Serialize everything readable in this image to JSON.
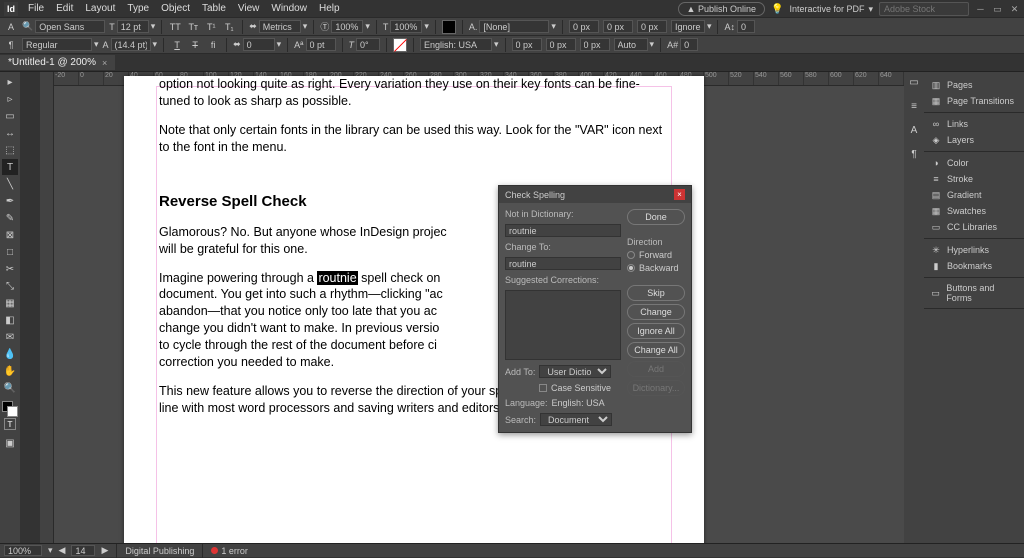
{
  "app": {
    "logo_letter": "Id"
  },
  "menu": [
    "File",
    "Edit",
    "Layout",
    "Type",
    "Object",
    "Table",
    "View",
    "Window",
    "Help"
  ],
  "topright": {
    "publish": "Publish Online",
    "preset_label": "Interactive for PDF",
    "search_placeholder": "Adobe Stock"
  },
  "control": {
    "font": "Open Sans",
    "weight": "Regular",
    "size": "12 pt",
    "leading": "(14.4 pt)",
    "metrics": "Metrics",
    "tracking": "0",
    "vscale": "100%",
    "hscale": "100%",
    "baseline": "0 pt",
    "skew": "0°",
    "lang": "English: USA",
    "para_style": "[None]",
    "zero": "0 px",
    "auto": "Auto",
    "ignore": "Ignore"
  },
  "tab": {
    "title": "*Untitled-1 @ 200%"
  },
  "ruler_ticks": [
    "-20",
    "0",
    "20",
    "40",
    "60",
    "80",
    "100",
    "120",
    "140",
    "160",
    "180",
    "200",
    "220",
    "240",
    "260",
    "280",
    "300",
    "320",
    "340",
    "360",
    "380",
    "400",
    "420",
    "440",
    "460",
    "480",
    "500",
    "520",
    "540",
    "560",
    "580",
    "600",
    "620",
    "640"
  ],
  "document": {
    "p1": "option not looking quite as right. Every variation they use on their key fonts can be fine-tuned to look as sharp as possible.",
    "p2": "Note that only certain fonts in the library can be used this way. Look for the \"VAR\" icon next to the font in the menu.",
    "h1": "Reverse Spell Check",
    "p3a": "Glamorous? No. But anyone whose InDesign projec",
    "p3b": "will be grateful for this one.",
    "p4a": "Imagine powering through a ",
    "p4b_hl": "routnie",
    "p4c": " spell check on",
    "p4d": "document. You get into such a rhythm—clicking \"ac",
    "p4e": "abandon—that you notice only too late that you ac",
    "p4f": "change you didn't want to make. In previous versio",
    "p4g": "to cycle through the rest of the document before ci",
    "p4h": "correction you needed to make.",
    "p5": "This new feature allows you to reverse the direction of your spell check, bringing InDesign in line with most word processors and saving writers and editors a lot of stress and time."
  },
  "dialog": {
    "title": "Check Spelling",
    "not_in_dict_label": "Not in Dictionary:",
    "not_in_dict_value": "routnie",
    "change_to_label": "Change To:",
    "change_to_value": "routine",
    "suggested_label": "Suggested Corrections:",
    "direction_label": "Direction",
    "forward": "Forward",
    "backward": "Backward",
    "done": "Done",
    "skip": "Skip",
    "change": "Change",
    "ignore_all": "Ignore All",
    "change_all": "Change All",
    "add": "Add",
    "dictionary": "Dictionary...",
    "add_to_label": "Add To:",
    "add_to_value": "User Dictionary",
    "case_sensitive": "Case Sensitive",
    "language_label": "Language:",
    "language_value": "English: USA",
    "search_label": "Search:",
    "search_value": "Document"
  },
  "right_panel": {
    "pages": "Pages",
    "page_transitions": "Page Transitions",
    "links": "Links",
    "layers": "Layers",
    "color": "Color",
    "stroke": "Stroke",
    "gradient": "Gradient",
    "swatches": "Swatches",
    "cc_libraries": "CC Libraries",
    "hyperlinks": "Hyperlinks",
    "bookmarks": "Bookmarks",
    "buttons_forms": "Buttons and Forms"
  },
  "status": {
    "zoom": "100%",
    "nav": "14",
    "profile": "Digital Publishing",
    "errors": "1 error"
  }
}
